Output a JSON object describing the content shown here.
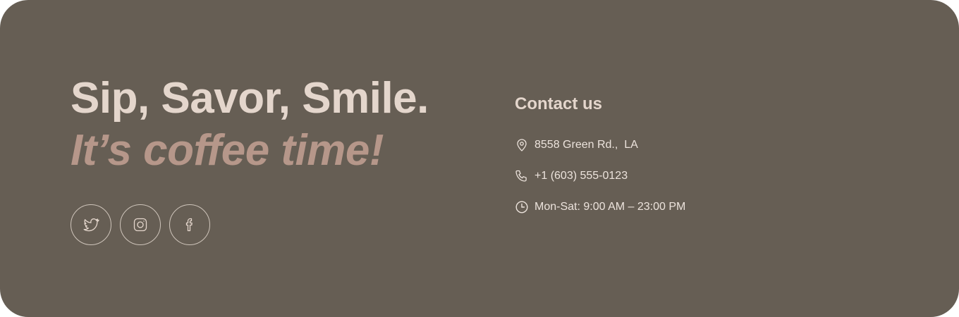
{
  "tagline": {
    "line1": "Sip, Savor, Smile.",
    "line2": "It’s coffee time!"
  },
  "socials": [
    {
      "icon": "twitter-icon"
    },
    {
      "icon": "instagram-icon"
    },
    {
      "icon": "facebook-icon"
    }
  ],
  "contact": {
    "title": "Contact us",
    "address": "8558 Green Rd.,  LA",
    "phone": "+1 (603) 555-0123",
    "hours": "Mon-Sat: 9:00 AM – 23:00 PM"
  },
  "colors": {
    "background": "#665e54",
    "heading": "#e4d6cc",
    "accent": "#b6978a",
    "text": "#ece3dc",
    "outline": "#cfc5bb"
  }
}
